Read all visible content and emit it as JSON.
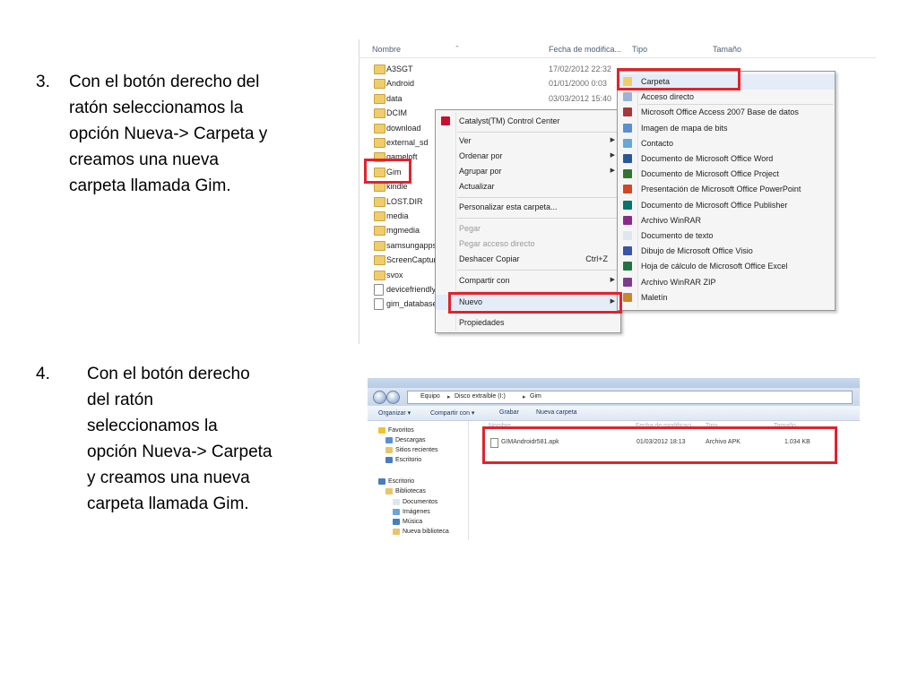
{
  "step3": {
    "number": "3.",
    "text": "Con el botón derecho del\nratón seleccionamos la\nopción Nueva-> Carpeta y\ncreamos una nueva\ncarpeta llamada Gim."
  },
  "step4": {
    "number": "4.",
    "text": "Con el botón derecho\ndel ratón\nseleccionamos la\nopción Nueva-> Carpeta\ny creamos una nueva\ncarpeta llamada Gim."
  },
  "explorer1": {
    "columns": {
      "name": "Nombre",
      "date": "Fecha de modifica...",
      "type": "Tipo",
      "size": "Tamaño"
    },
    "rows": [
      {
        "name": "A3SGT",
        "date": "17/02/2012 22:32",
        "icon": "folder-icon"
      },
      {
        "name": "Android",
        "date": "01/01/2000 0:03",
        "icon": "folder-icon"
      },
      {
        "name": "data",
        "date": "03/03/2012 15:40",
        "icon": "folder-icon"
      },
      {
        "name": "DCIM",
        "date": "",
        "icon": "folder-icon"
      },
      {
        "name": "download",
        "date": "",
        "icon": "folder-icon"
      },
      {
        "name": "external_sd",
        "date": "",
        "icon": "folder-icon"
      },
      {
        "name": "gameloft",
        "date": "",
        "icon": "folder-icon"
      },
      {
        "name": "Gim",
        "date": "",
        "icon": "folder-icon"
      },
      {
        "name": "kindle",
        "date": "",
        "icon": "folder-icon"
      },
      {
        "name": "LOST.DIR",
        "date": "",
        "icon": "folder-icon"
      },
      {
        "name": "media",
        "date": "",
        "icon": "folder-icon"
      },
      {
        "name": "mgmedia",
        "date": "",
        "icon": "folder-icon"
      },
      {
        "name": "samsungapps",
        "date": "",
        "icon": "folder-icon"
      },
      {
        "name": "ScreenCaptur",
        "date": "",
        "icon": "folder-icon"
      },
      {
        "name": "svox",
        "date": "",
        "icon": "folder-icon"
      },
      {
        "name": "devicefriendly",
        "date": "",
        "icon": "file-icon"
      },
      {
        "name": "gim_database",
        "date": "",
        "icon": "file-icon"
      }
    ],
    "context_menu": {
      "catalyst": "Catalyst(TM) Control Center",
      "ver": "Ver",
      "ordenar": "Ordenar por",
      "agrupar": "Agrupar por",
      "actualizar": "Actualizar",
      "personalizar": "Personalizar esta carpeta...",
      "pegar": "Pegar",
      "pegar_acceso": "Pegar acceso directo",
      "deshacer": "Deshacer Copiar",
      "deshacer_shortcut": "Ctrl+Z",
      "compartir": "Compartir con",
      "nuevo": "Nuevo",
      "propiedades": "Propiedades"
    },
    "submenu": [
      {
        "label": "Carpeta",
        "color": "#f0cd6b"
      },
      {
        "label": "Acceso directo",
        "color": "#9ab3d6"
      },
      {
        "label": "Microsoft Office Access 2007 Base de datos",
        "color": "#a4373a"
      },
      {
        "label": "Imagen de mapa de bits",
        "color": "#5b8fd1"
      },
      {
        "label": "Contacto",
        "color": "#6aa6d8"
      },
      {
        "label": "Documento de Microsoft Office Word",
        "color": "#2b579a"
      },
      {
        "label": "Documento de Microsoft Office Project",
        "color": "#31752f"
      },
      {
        "label": "Presentación de Microsoft Office PowerPoint",
        "color": "#d24726"
      },
      {
        "label": "Documento de Microsoft Office Publisher",
        "color": "#077568"
      },
      {
        "label": "Archivo WinRAR",
        "color": "#8b2a8d"
      },
      {
        "label": "Documento de texto",
        "color": "#dfe6ee"
      },
      {
        "label": "Dibujo de Microsoft Office Visio",
        "color": "#3955a3"
      },
      {
        "label": "Hoja de cálculo de Microsoft Office Excel",
        "color": "#217346"
      },
      {
        "label": "Archivo WinRAR ZIP",
        "color": "#7b3c8e"
      },
      {
        "label": "Maletín",
        "color": "#c8872c"
      }
    ]
  },
  "explorer2": {
    "breadcrumb": {
      "equipo": "Equipo",
      "disco": "Disco extraíble (I:)",
      "gim": "Gim"
    },
    "toolbar": {
      "organizar": "Organizar ▾",
      "compartir": "Compartir con ▾",
      "grabar": "Grabar",
      "nueva_carpeta": "Nueva carpeta"
    },
    "nav": [
      {
        "label": "Favoritos",
        "indent": 0,
        "color": "#f2c130"
      },
      {
        "label": "Descargas",
        "indent": 1,
        "color": "#5b8fd1"
      },
      {
        "label": "Sitios recientes",
        "indent": 1,
        "color": "#e8c46a"
      },
      {
        "label": "Escritorio",
        "indent": 1,
        "color": "#4a7cc0"
      },
      {
        "label": "Escritorio",
        "indent": 0,
        "color": "#4a7cc0"
      },
      {
        "label": "Bibliotecas",
        "indent": 1,
        "color": "#e8c46a"
      },
      {
        "label": "Documentos",
        "indent": 2,
        "color": "#dfe6ee"
      },
      {
        "label": "Imágenes",
        "indent": 2,
        "color": "#6aa6d8"
      },
      {
        "label": "Música",
        "indent": 2,
        "color": "#4a7cc0"
      },
      {
        "label": "Nueva biblioteca",
        "indent": 2,
        "color": "#e8c46a"
      }
    ],
    "columns": {
      "name": "Nombre",
      "date": "Fecha de modificaci...",
      "type": "Tipo",
      "size": "Tamaño"
    },
    "file": {
      "name": "GIMAndroidr581.apk",
      "date": "01/03/2012 18:13",
      "type": "Archivo APK",
      "size": "1.034 KB"
    }
  }
}
